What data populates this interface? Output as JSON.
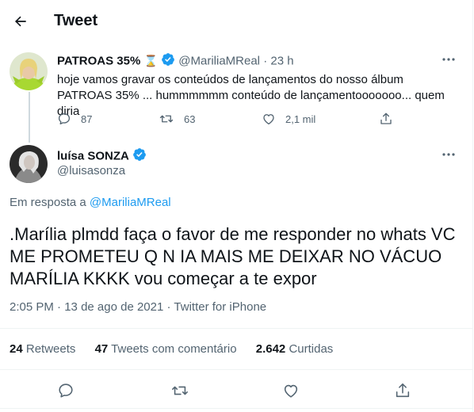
{
  "header": {
    "title": "Tweet"
  },
  "parent_tweet": {
    "name": "PATROAS 35%",
    "name_emoji": "⌛",
    "handle": "@MariliaMReal",
    "separator": "·",
    "time": "23 h",
    "text": "hoje vamos gravar os conteúdos de lançamentos do nosso álbum PATROAS 35% ... hummmmmm conteúdo de lançamentooooooo... quem diria",
    "replies": "87",
    "retweets": "63",
    "likes": "2,1 mil"
  },
  "main_tweet": {
    "name": "luísa SONZA",
    "handle": "@luisasonza",
    "reply_prefix": "Em resposta a",
    "reply_handle": "@MariliaMReal",
    "text": ".Marília plmdd faça o favor de me responder no whats VC ME PROMETEU Q N IA MAIS ME DEIXAR NO VÁCUO MARÍLIA KKKK vou começar a te expor",
    "time": "2:05 PM",
    "dot": "·",
    "date": "13 de ago de 2021",
    "source": "Twitter for iPhone",
    "retweets_count": "24",
    "retweets_label": "Retweets",
    "quotes_count": "47",
    "quotes_label": "Tweets com comentário",
    "likes_count": "2.642",
    "likes_label": "Curtidas"
  },
  "colors": {
    "accent": "#1d9bf0",
    "secondary_text": "#536471",
    "divider": "#eff3f4"
  },
  "icons": [
    "back-arrow-icon",
    "verified-badge-icon",
    "hourglass-icon",
    "more-icon",
    "reply-icon",
    "retweet-icon",
    "like-icon",
    "share-icon"
  ]
}
